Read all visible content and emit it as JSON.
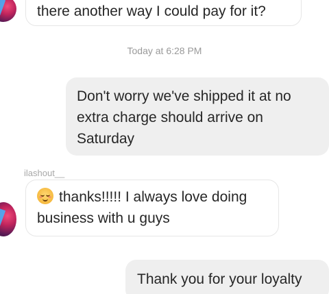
{
  "messages": {
    "m1": {
      "text": "there another way I could pay for it?"
    },
    "timestamp": "Today at 6:28 PM",
    "m2": {
      "text": "Don't worry we've shipped it at no extra charge should arrive on Saturday"
    },
    "m3": {
      "sender": "ilashout__",
      "text": "thanks!!!!! I always love doing business with u guys",
      "emoji": "smiling-face-with-smiling-eyes"
    },
    "m4": {
      "text": "Thank you for your loyalty"
    }
  }
}
